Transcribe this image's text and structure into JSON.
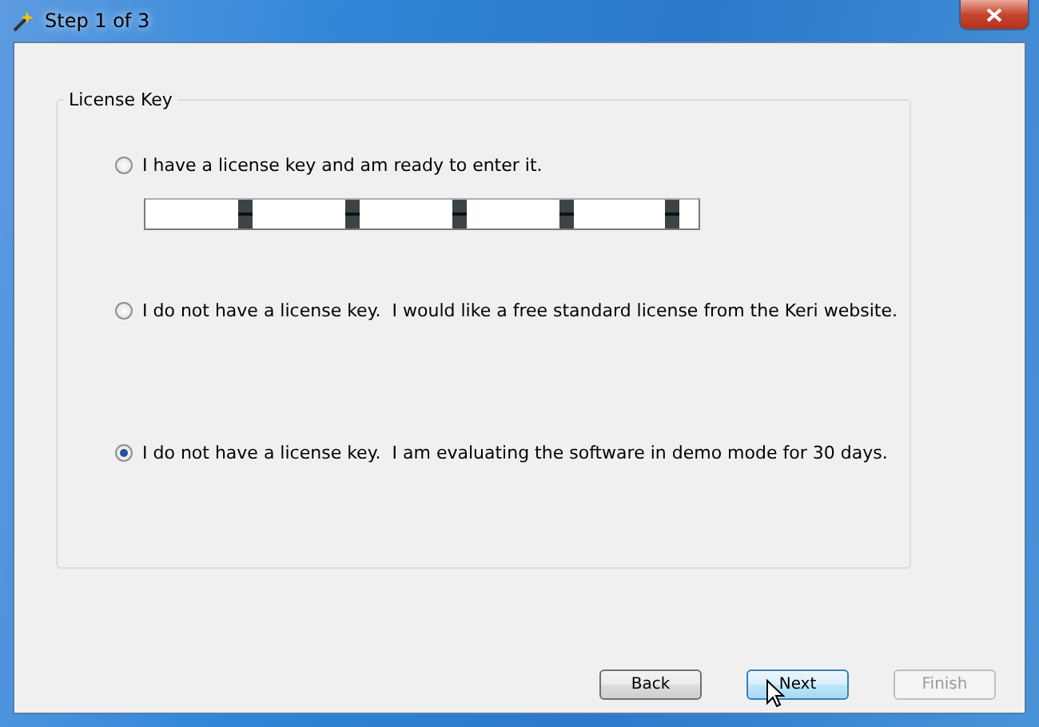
{
  "window": {
    "title": "Step 1 of 3"
  },
  "group": {
    "title": "License Key",
    "options": [
      {
        "label": "I have a license key and am ready to enter it.",
        "selected": false,
        "kind": "key-entry"
      },
      {
        "label": "I do not have a license key.  I would like a free standard license from the Keri website.",
        "selected": false,
        "kind": "plain"
      },
      {
        "label": "I do not have a license key.  I am evaluating the software in demo mode for 30 days.",
        "selected": true,
        "kind": "plain"
      }
    ]
  },
  "buttons": [
    {
      "label": "Back",
      "disabled": false,
      "highlighted": false
    },
    {
      "label": "Next",
      "disabled": false,
      "highlighted": true
    },
    {
      "label": "Finish",
      "disabled": true,
      "highlighted": false
    }
  ]
}
